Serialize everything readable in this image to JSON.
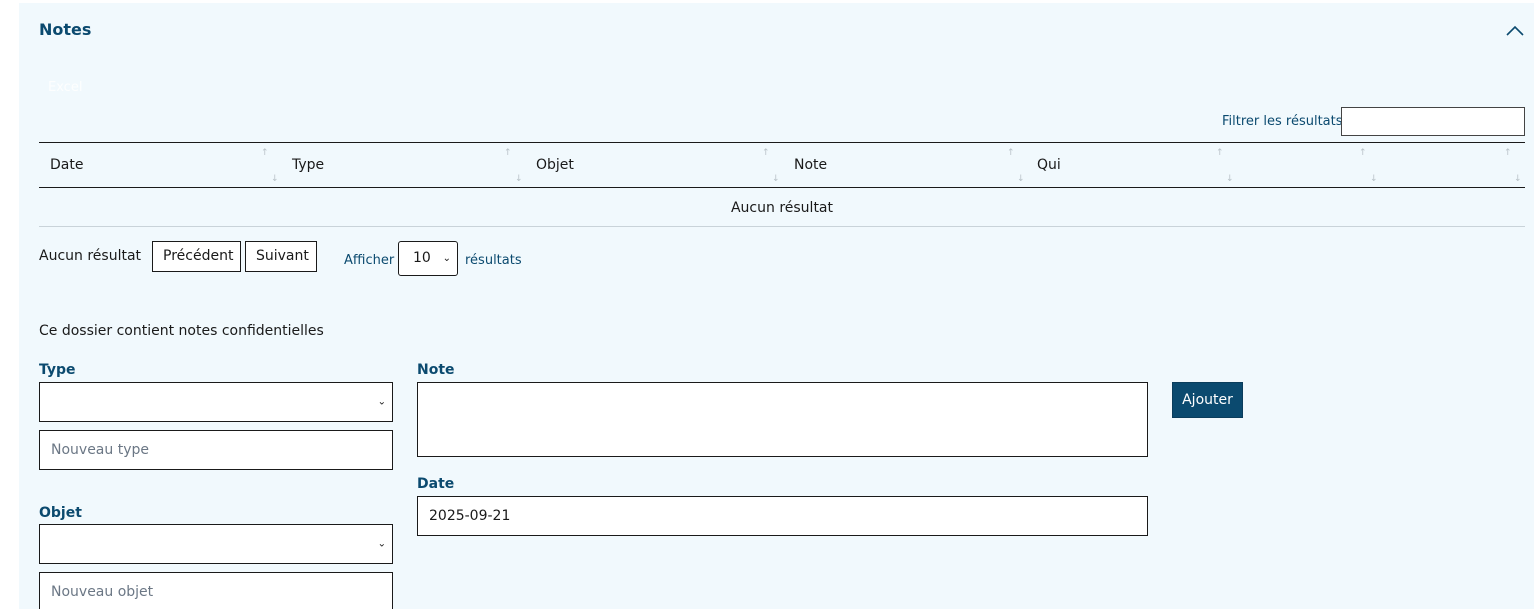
{
  "section": {
    "title": "Notes",
    "export_label": "Excel"
  },
  "filter": {
    "label": "Filtrer les résultats",
    "value": ""
  },
  "table": {
    "columns": [
      "Date",
      "Type",
      "Objet",
      "Note",
      "Qui",
      "",
      ""
    ],
    "empty_text": "Aucun résultat"
  },
  "pagination": {
    "info": "Aucun résultat",
    "prev_label": "Précédent",
    "next_label": "Suivant",
    "show_label": "Afficher",
    "page_size": "10",
    "results_label": "résultats"
  },
  "form": {
    "confidential_text": "Ce dossier contient notes confidentielles",
    "type_label": "Type",
    "type_value": "",
    "new_type_placeholder": "Nouveau type",
    "objet_label": "Objet",
    "objet_value": "",
    "new_objet_placeholder": "Nouveau objet",
    "note_label": "Note",
    "note_value": "",
    "date_label": "Date",
    "date_value": "2025-09-21",
    "add_label": "Ajouter"
  },
  "colors": {
    "panel_bg": "#f1f9fd",
    "accent": "#0b4a6f"
  },
  "icons": {
    "collapse": "chevron-up-icon",
    "select": "chevron-down-icon",
    "sort": "sort-arrows-icon"
  }
}
